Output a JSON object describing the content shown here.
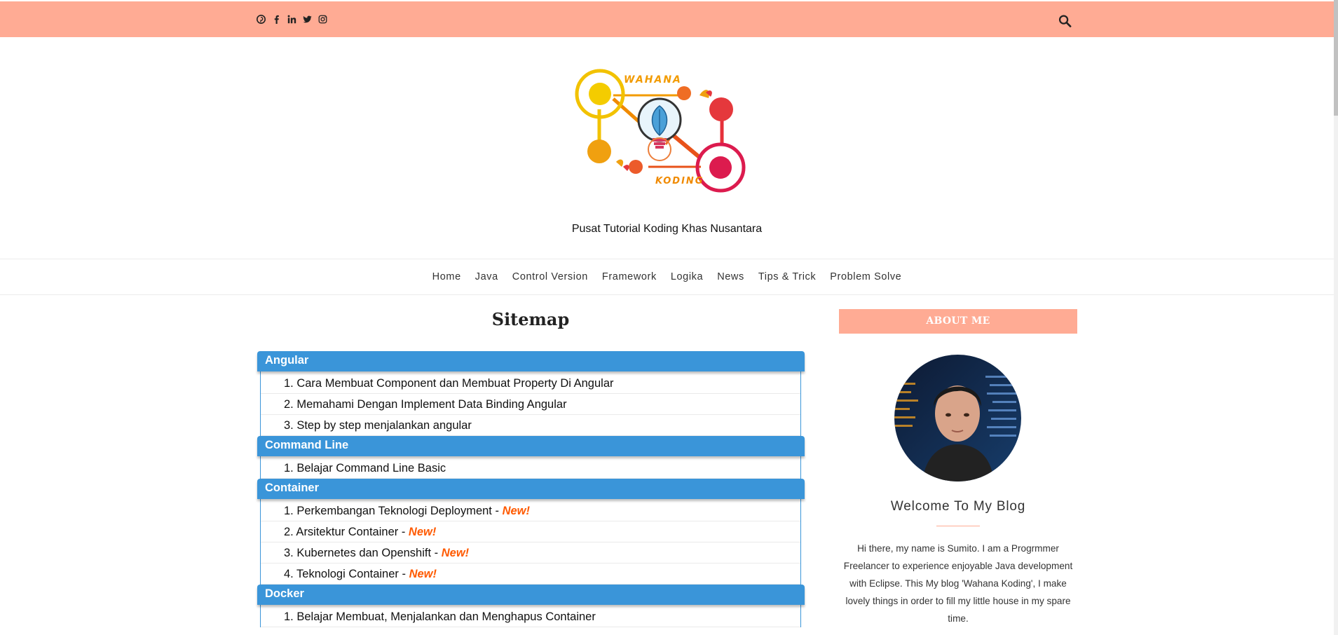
{
  "topbar": {
    "social_icons": [
      "pinterest-icon",
      "facebook-icon",
      "linkedin-icon",
      "twitter-icon",
      "instagram-icon"
    ],
    "search_icon": "search-icon",
    "background": "#ffab94"
  },
  "header": {
    "logo_text_top": "WAHANA",
    "logo_text_bottom": "KODING",
    "tagline": "Pusat Tutorial Koding Khas Nusantara"
  },
  "nav": {
    "items": [
      "Home",
      "Java",
      "Control Version",
      "Framework",
      "Logika",
      "News",
      "Tips & Trick",
      "Problem Solve"
    ]
  },
  "main": {
    "title": "Sitemap",
    "new_label": "New!",
    "categories": [
      {
        "name": "Angular",
        "items": [
          {
            "text": "1. Cara Membuat Component dan Membuat Property Di Angular",
            "is_new": false
          },
          {
            "text": "2. Memahami Dengan Implement Data Binding Angular",
            "is_new": false
          },
          {
            "text": "3. Step by step menjalankan angular",
            "is_new": false
          }
        ]
      },
      {
        "name": "Command Line",
        "items": [
          {
            "text": "1. Belajar Command Line Basic",
            "is_new": false
          }
        ]
      },
      {
        "name": "Container",
        "items": [
          {
            "text": "1. Perkembangan Teknologi Deployment",
            "is_new": true
          },
          {
            "text": "2. Arsitektur Container",
            "is_new": true
          },
          {
            "text": "3. Kubernetes dan Openshift",
            "is_new": true
          },
          {
            "text": "4. Teknologi Container",
            "is_new": true
          }
        ]
      },
      {
        "name": "Docker",
        "items": [
          {
            "text": "1. Belajar Membuat, Menjalankan dan Menghapus Container",
            "is_new": false
          }
        ]
      }
    ]
  },
  "sidebar": {
    "about_title": "ABOUT ME",
    "welcome": "Welcome To My Blog",
    "about_lines": [
      "Hi there, my name is Sumito. I am a Progrmmer",
      "Freelancer to experience enjoyable Java development",
      "with Eclipse. This My blog 'Wahana Koding', I make",
      "lovely things in order to fill my little house in my spare",
      "time."
    ]
  },
  "colors": {
    "accent": "#ffab94",
    "category_header": "#3a95d9",
    "new_badge": "#ff5a00"
  }
}
